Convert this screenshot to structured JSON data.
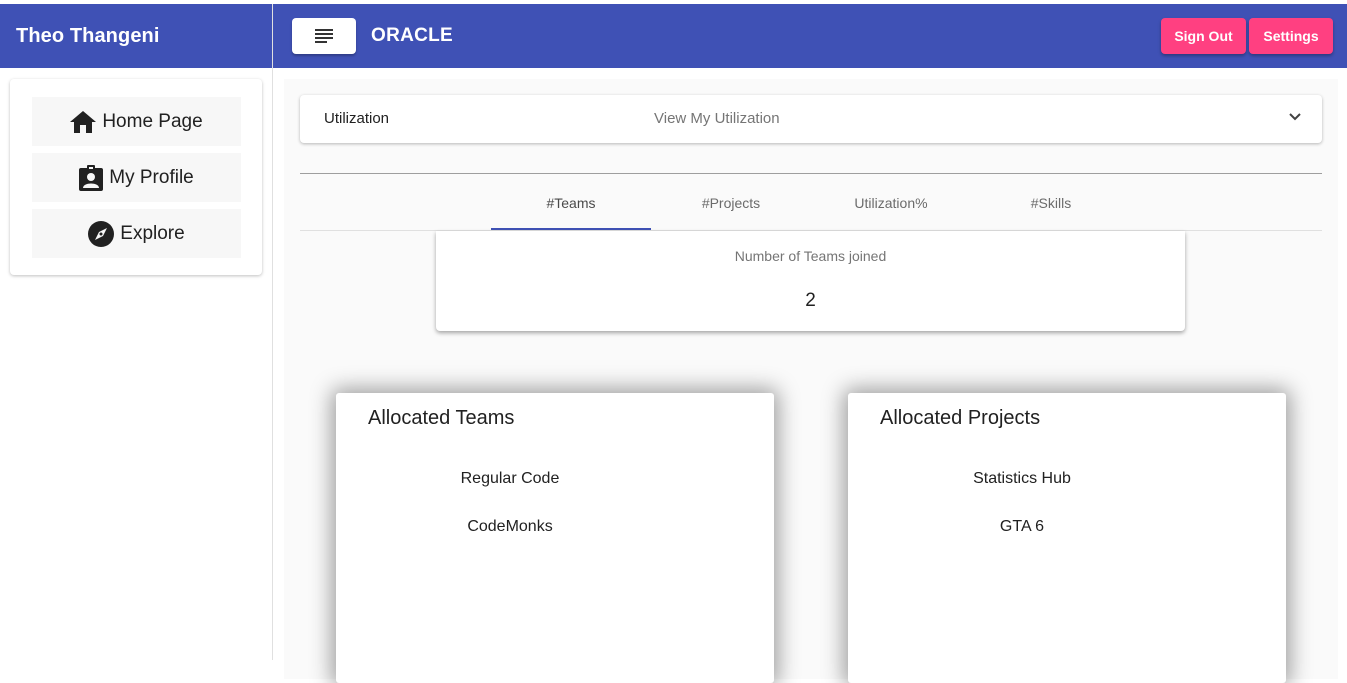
{
  "header": {
    "user_name": "Theo Thangeni",
    "brand": "ORACLE",
    "sign_out_label": "Sign Out",
    "settings_label": "Settings",
    "primary_color": "#3f51b5",
    "accent_color": "#ff4081"
  },
  "sidebar": {
    "items": [
      {
        "label": "Home Page",
        "icon": "home-icon"
      },
      {
        "label": "My Profile",
        "icon": "badge-icon"
      },
      {
        "label": "Explore",
        "icon": "compass-icon"
      }
    ]
  },
  "utilization": {
    "title": "Utilization",
    "description": "View My Utilization"
  },
  "tabs": [
    {
      "label": "#Teams",
      "active": true
    },
    {
      "label": "#Projects",
      "active": false
    },
    {
      "label": "Utilization%",
      "active": false
    },
    {
      "label": "#Skills",
      "active": false
    }
  ],
  "stat": {
    "label": "Number of Teams joined",
    "value": "2"
  },
  "allocated_teams": {
    "title": "Allocated Teams",
    "items": [
      "Regular Code",
      "CodeMonks"
    ]
  },
  "allocated_projects": {
    "title": "Allocated Projects",
    "items": [
      "Statistics Hub",
      "GTA 6"
    ]
  }
}
